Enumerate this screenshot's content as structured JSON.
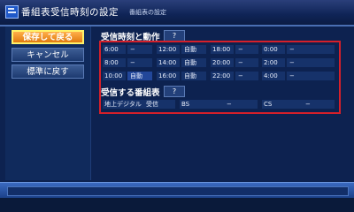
{
  "header": {
    "title": "番組表受信時刻の設定",
    "subtitle": "番組表の設定"
  },
  "menu": {
    "save_label": "保存して戻る",
    "cancel_label": "キャンセル",
    "reset_label": "標準に戻す"
  },
  "receive_time": {
    "heading": "受信時刻と動作",
    "help_label": "?",
    "rows": [
      [
        {
          "time": "6:00",
          "action": "−"
        },
        {
          "time": "12:00",
          "action": "自動"
        },
        {
          "time": "18:00",
          "action": "−"
        },
        {
          "time": "0:00",
          "action": "−"
        }
      ],
      [
        {
          "time": "8:00",
          "action": "−"
        },
        {
          "time": "14:00",
          "action": "自動"
        },
        {
          "time": "20:00",
          "action": "−"
        },
        {
          "time": "2:00",
          "action": "−"
        }
      ],
      [
        {
          "time": "10:00",
          "action": "自動"
        },
        {
          "time": "16:00",
          "action": "自動"
        },
        {
          "time": "22:00",
          "action": "−"
        },
        {
          "time": "4:00",
          "action": "−"
        }
      ]
    ]
  },
  "epg": {
    "heading": "受信する番組表",
    "help_label": "?",
    "items": [
      {
        "name": "地上デジタル",
        "value": "受信"
      },
      {
        "name": "BS",
        "value": "−"
      },
      {
        "name": "CS",
        "value": "−"
      }
    ]
  },
  "colors": {
    "accent_orange": "#e07a10",
    "highlight_yellow": "#fff26a",
    "frame_red": "#d5202a",
    "panel_blue": "#0d2250"
  },
  "icons": {
    "app_icon": "list-icon"
  }
}
